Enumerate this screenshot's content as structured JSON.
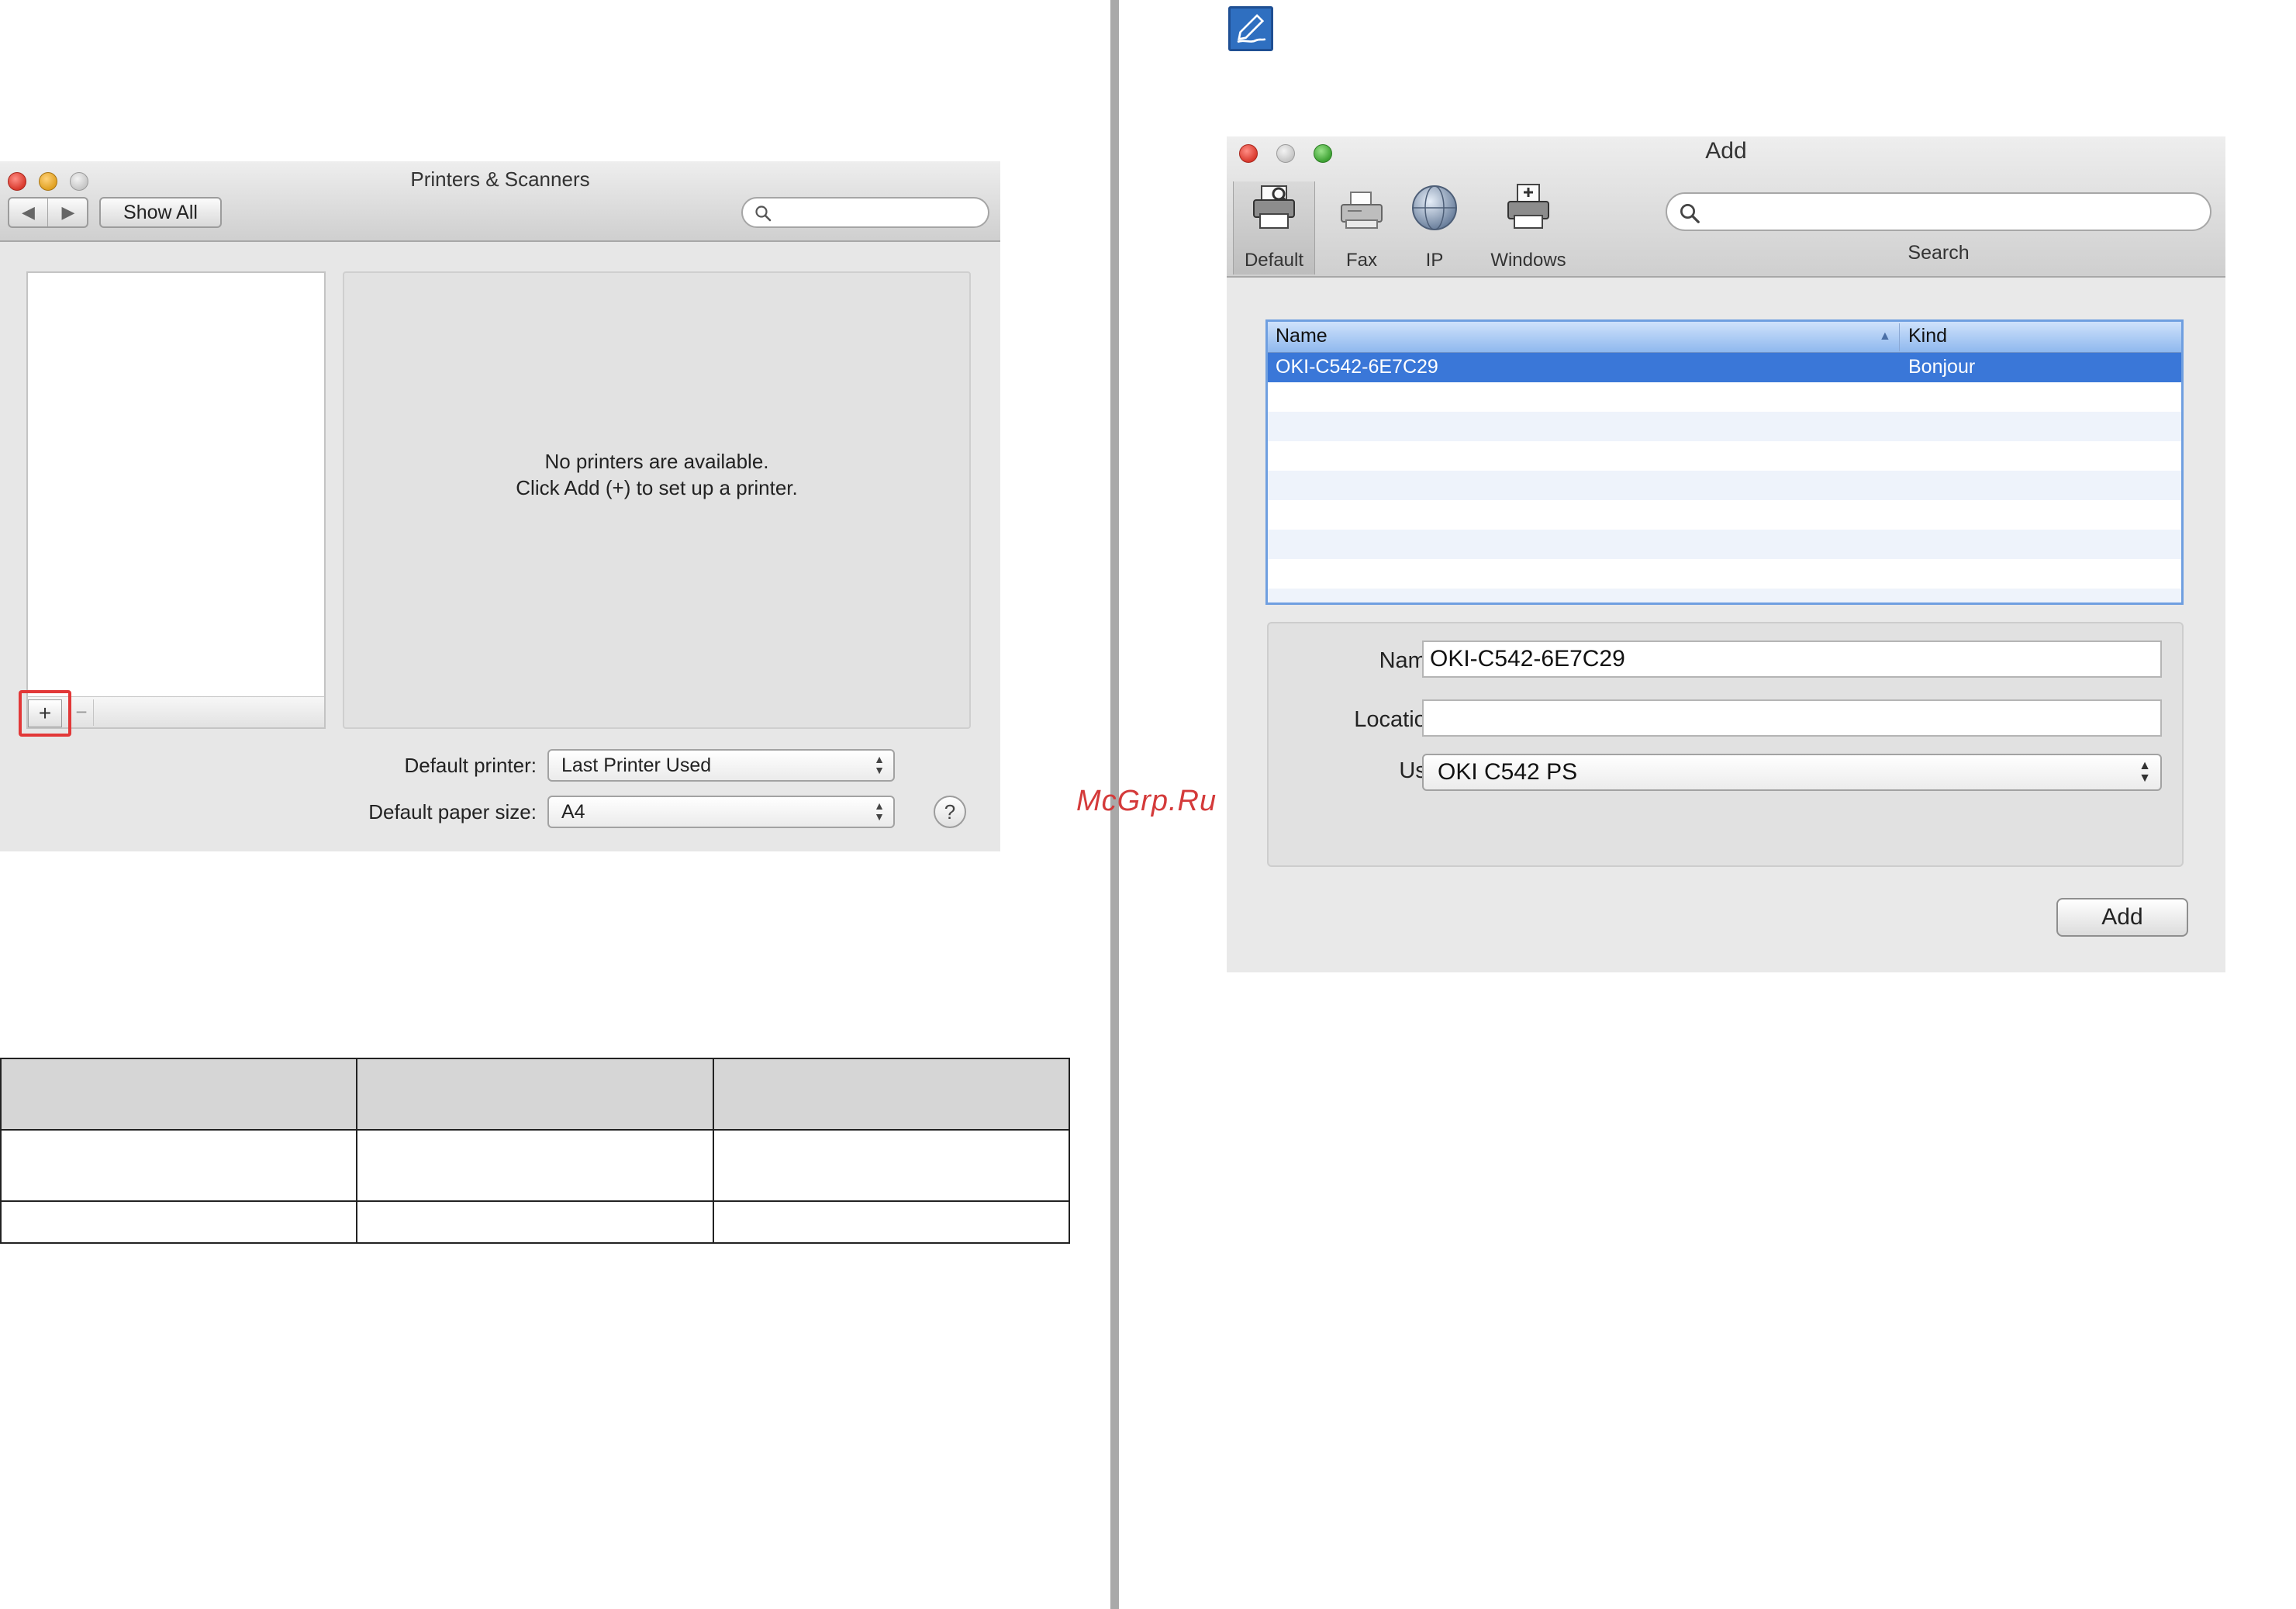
{
  "watermark": "McGrp.Ru",
  "icons": {
    "note": "note-pencil-icon",
    "search": "search-icon",
    "printer": "printer-icon",
    "fax": "fax-icon",
    "ip": "globe-icon",
    "windows": "windows-printer-icon",
    "help": "help-icon"
  },
  "colors": {
    "accent_selection": "#3a77d8",
    "highlight_frame": "#e23838",
    "watermark": "#d43a3a"
  },
  "printers_window": {
    "title": "Printers & Scanners",
    "nav_back": "◀",
    "nav_forward": "▶",
    "show_all": "Show All",
    "search_placeholder": "",
    "add_button": "+",
    "remove_button": "−",
    "message_line1": "No printers are available.",
    "message_line2": "Click Add (+) to set up a printer.",
    "default_printer_label": "Default printer:",
    "default_printer_value": "Last Printer Used",
    "default_paper_label": "Default paper size:",
    "default_paper_value": "A4",
    "help": "?"
  },
  "add_window": {
    "title": "Add",
    "toolbar": {
      "default": "Default",
      "fax": "Fax",
      "ip": "IP",
      "windows": "Windows"
    },
    "search_label": "Search",
    "table": {
      "columns": [
        "Name",
        "Kind"
      ],
      "rows": [
        {
          "name": "OKI-C542-6E7C29",
          "kind": "Bonjour",
          "selected": true
        }
      ]
    },
    "form": {
      "name_label": "Name:",
      "name_value": "OKI-C542-6E7C29",
      "location_label": "Location:",
      "location_value": "",
      "use_label": "Use:",
      "use_value": "OKI C542 PS"
    },
    "add_button": "Add"
  }
}
